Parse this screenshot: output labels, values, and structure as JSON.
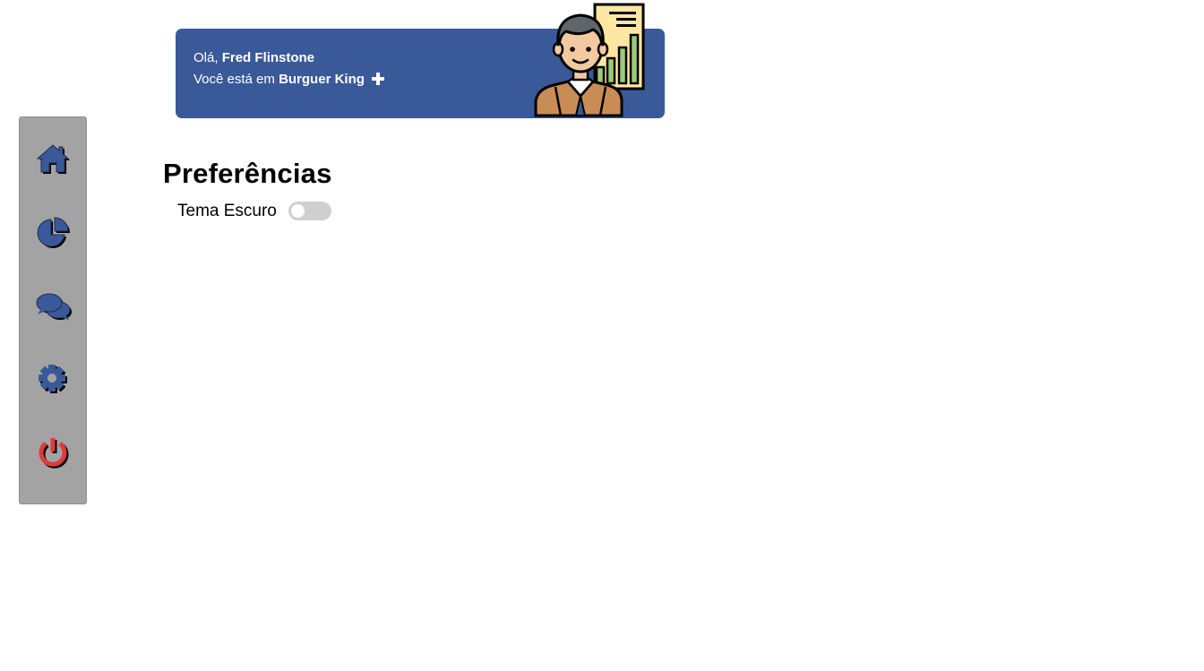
{
  "header": {
    "greeting_prefix": "Olá,",
    "user_name": "Fred Flinstone",
    "location_prefix": "Você está em",
    "location_name": "Burguer King",
    "add_location_icon": "plus-icon",
    "avatar": "businessman-with-chart-avatar"
  },
  "sidebar": {
    "items": [
      {
        "id": "home",
        "icon": "home-icon",
        "color": "#3a5999"
      },
      {
        "id": "dashboard",
        "icon": "pie-chart-icon",
        "color": "#3a5999"
      },
      {
        "id": "chat",
        "icon": "chat-bubbles-icon",
        "color": "#3a5999"
      },
      {
        "id": "settings",
        "icon": "gear-icon",
        "color": "#3a5999"
      },
      {
        "id": "logout",
        "icon": "power-icon",
        "color": "#e03a3a"
      }
    ]
  },
  "preferences": {
    "title": "Preferências",
    "dark_theme_label": "Tema Escuro",
    "dark_theme_enabled": false
  },
  "colors": {
    "brand": "#3a5999",
    "sidebar_bg": "#a3a3a3",
    "toggle_off": "#cfcfcf",
    "power": "#e03a3a"
  }
}
